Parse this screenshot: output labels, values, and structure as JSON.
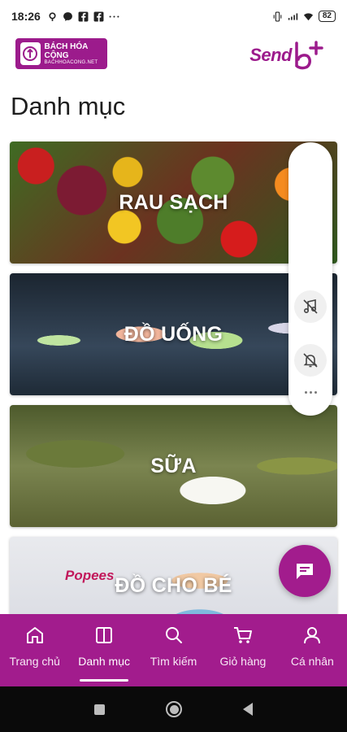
{
  "status_bar": {
    "time": "18:26",
    "battery": "82",
    "icons": [
      "location-icon",
      "messenger-icon",
      "facebook-icon",
      "facebook-icon",
      "more-icon",
      "vibrate-icon",
      "signal-icon",
      "wifi-icon",
      "battery-icon"
    ]
  },
  "header": {
    "logo_name": "BÁCH HÓA CỘNG",
    "logo_url": "BACHHOACONG.NET",
    "partner_logo": "Send"
  },
  "page": {
    "title": "Danh mục"
  },
  "categories": [
    {
      "label": "RAU SẠCH"
    },
    {
      "label": "ĐỒ UỐNG"
    },
    {
      "label": "SỮA"
    },
    {
      "label": "ĐỒ CHO BÉ",
      "brand": "Popees"
    }
  ],
  "side_panel": {
    "icons": [
      "music-off-icon",
      "bell-off-icon",
      "more-dots-icon"
    ]
  },
  "bottom_nav": {
    "items": [
      {
        "label": "Trang chủ",
        "icon": "home-icon"
      },
      {
        "label": "Danh mục",
        "icon": "category-icon",
        "active": true
      },
      {
        "label": "Tìm kiếm",
        "icon": "search-icon"
      },
      {
        "label": "Giỏ hàng",
        "icon": "cart-icon"
      },
      {
        "label": "Cá nhân",
        "icon": "user-icon"
      }
    ]
  },
  "colors": {
    "brand": "#a21c8d",
    "nav_text": "#ffffff"
  }
}
